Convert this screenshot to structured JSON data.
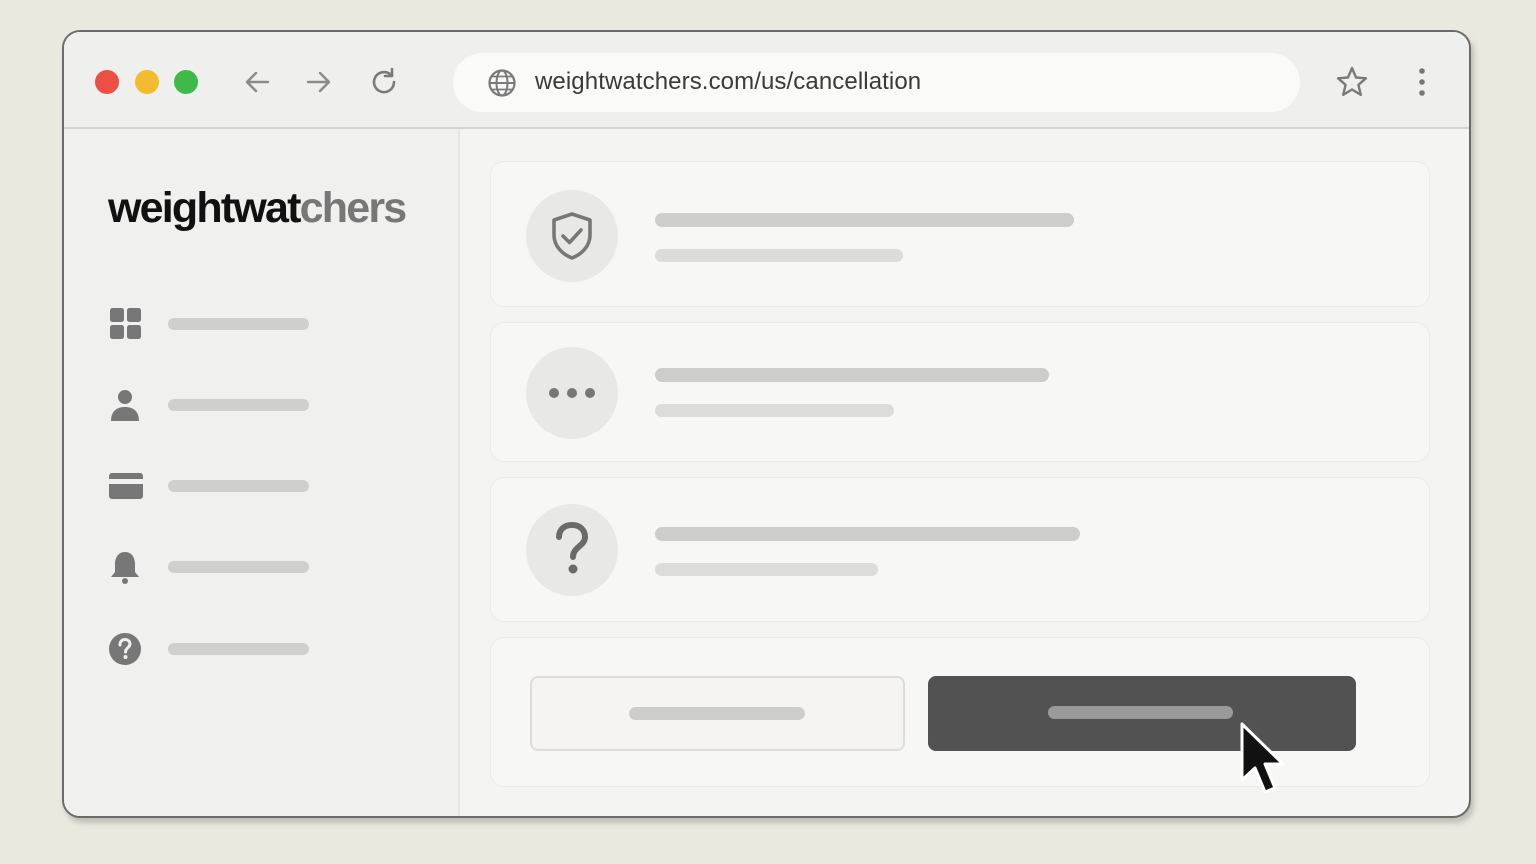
{
  "browser": {
    "url": "weightwatchers.com/us/cancellation",
    "icons": {
      "back": "arrow-left-icon",
      "forward": "arrow-right-icon",
      "reload": "reload-icon",
      "site": "globe-icon",
      "bookmark": "star-icon",
      "menu": "kebab-menu-icon"
    }
  },
  "sidebar": {
    "logo": {
      "primary": "weightwat",
      "secondary": "chers"
    },
    "items": [
      {
        "icon": "grid-icon"
      },
      {
        "icon": "user-icon"
      },
      {
        "icon": "credit-card-icon"
      },
      {
        "icon": "bell-icon"
      },
      {
        "icon": "help-circle-icon"
      }
    ]
  },
  "main": {
    "cards": [
      {
        "icon": "shield-check-icon"
      },
      {
        "icon": "more-horizontal-icon"
      },
      {
        "icon": "question-mark-icon"
      }
    ],
    "actions": {
      "secondary_icon": "",
      "primary_icon": ""
    }
  },
  "colors": {
    "close": "#ec4f43",
    "minimize": "#f4bb2f",
    "maximize": "#3dba49",
    "primary_button": "#525252",
    "placeholder": "#cfcfcd"
  }
}
